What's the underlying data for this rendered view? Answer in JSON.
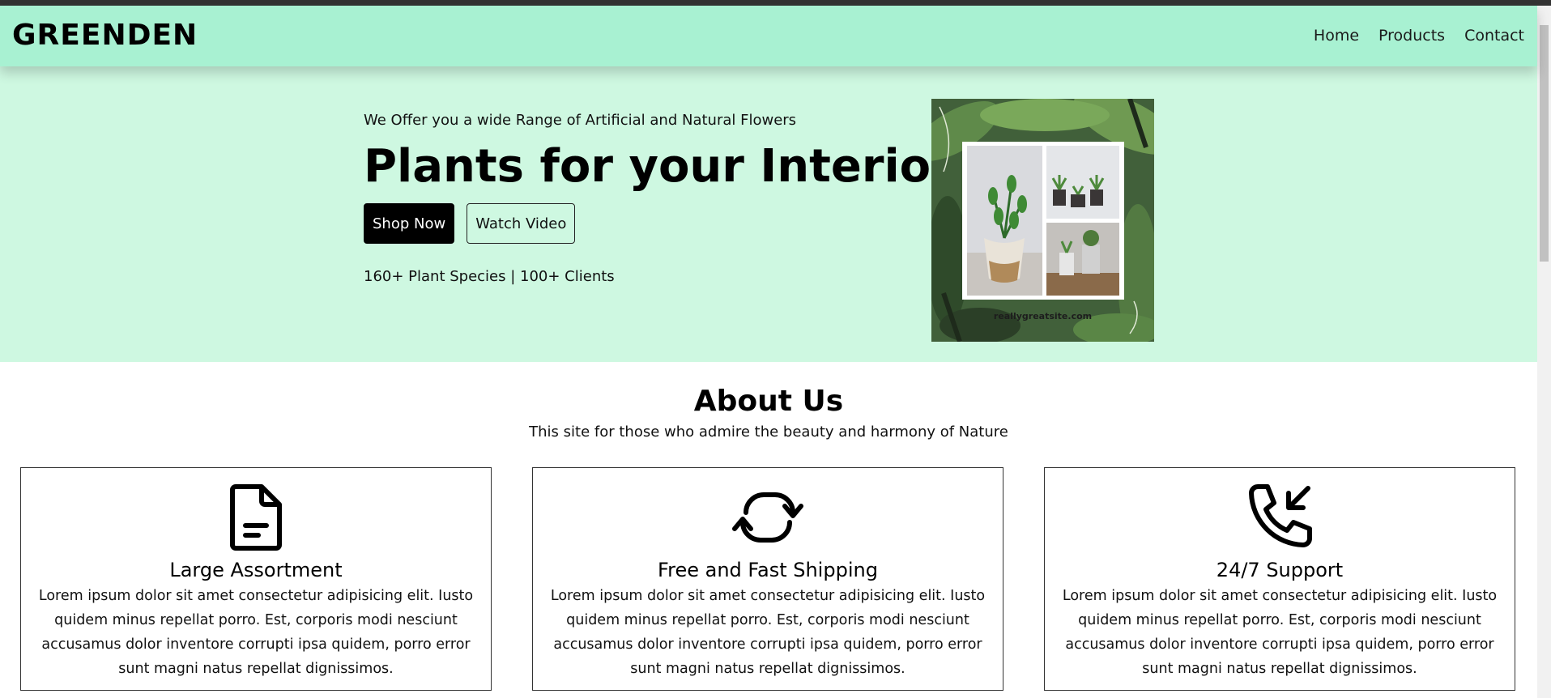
{
  "navbar": {
    "logo": "GREENDEN",
    "links": [
      "Home",
      "Products",
      "Contact"
    ]
  },
  "hero": {
    "tagline": "We Offer you a wide Range of Artificial and Natural Flowers",
    "title": "Plants for your Interior",
    "primary_button": "Shop Now",
    "secondary_button": "Watch Video",
    "stats": "160+ Plant Species | 100+ Clients",
    "image_caption": "reallygreatsite.com"
  },
  "about": {
    "title": "About Us",
    "subtitle": "This site for those who admire the beauty and harmony of Nature",
    "cards": [
      {
        "icon": "document-icon",
        "title": "Large Assortment",
        "text": "Lorem ipsum dolor sit amet consectetur adipisicing elit. Iusto quidem minus repellat porro. Est, corporis modi nesciunt accusamus dolor inventore corrupti ipsa quidem, porro error sunt magni natus repellat dignissimos."
      },
      {
        "icon": "refresh-icon",
        "title": "Free and Fast Shipping",
        "text": "Lorem ipsum dolor sit amet consectetur adipisicing elit. Iusto quidem minus repellat porro. Est, corporis modi nesciunt accusamus dolor inventore corrupti ipsa quidem, porro error sunt magni natus repellat dignissimos."
      },
      {
        "icon": "phone-incoming-icon",
        "title": "24/7 Support",
        "text": "Lorem ipsum dolor sit amet consectetur adipisicing elit. Iusto quidem minus repellat porro. Est, corporis modi nesciunt accusamus dolor inventore corrupti ipsa quidem, porro error sunt magni natus repellat dignissimos."
      }
    ]
  },
  "colors": {
    "navbar_bg": "#a8f1d2",
    "hero_bg": "#cef8e1",
    "primary_button_bg": "#000000"
  }
}
